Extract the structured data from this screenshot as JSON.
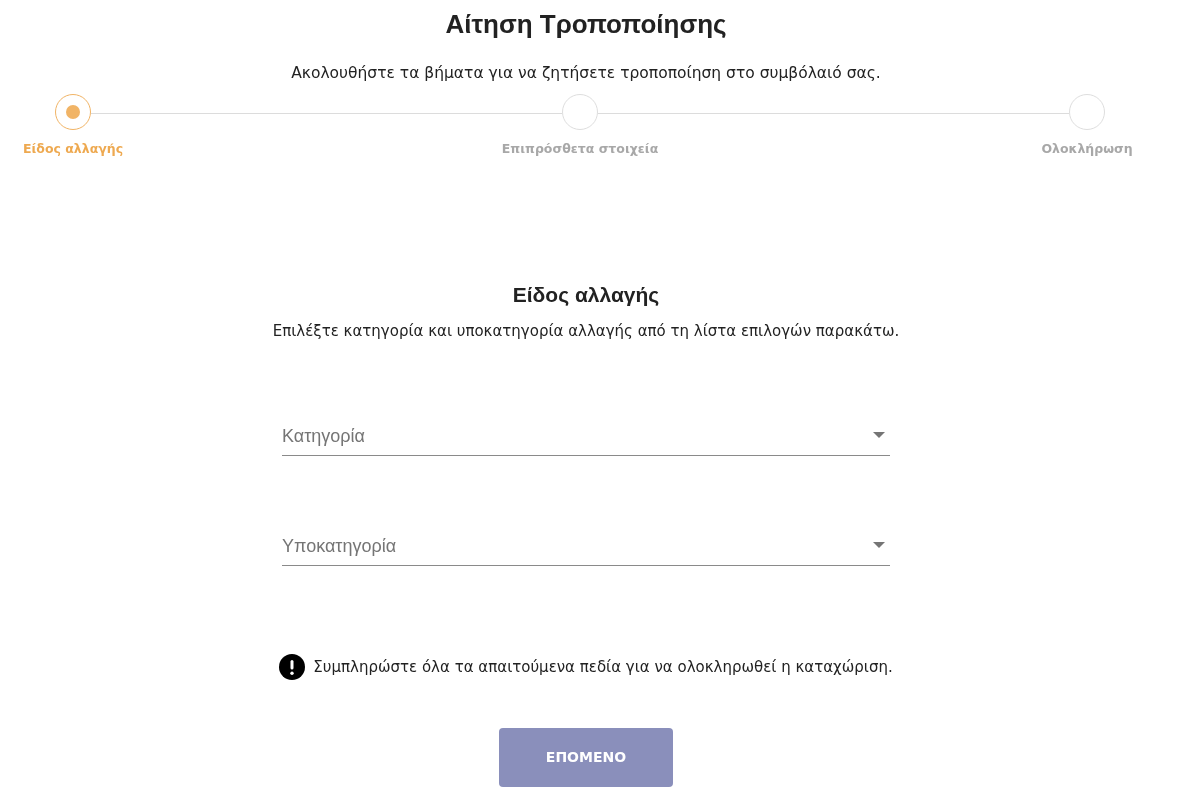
{
  "page": {
    "title": "Αίτηση Τροποποίησης",
    "subtitle": "Ακολουθήστε τα βήματα για να ζητήσετε τροποποίηση στο συμβόλαιό σας."
  },
  "steps": [
    {
      "label": "Είδος αλλαγής",
      "selected": true
    },
    {
      "label": "Επιπρόσθετα στοιχεία",
      "selected": false
    },
    {
      "label": "Ολοκλήρωση",
      "selected": false
    }
  ],
  "section": {
    "title": "Είδος αλλαγής",
    "description": "Επιλέξτε κατηγορία και υποκατηγορία αλλαγής από τη λίστα επιλογών παρακάτω."
  },
  "fields": [
    {
      "placeholder": "Κατηγορία"
    },
    {
      "placeholder": "Υποκατηγορία"
    }
  ],
  "notice": {
    "text": "Συμπληρώστε όλα τα απαιτούμενα πεδία για να ολοκληρωθεί η καταχώριση."
  },
  "button": {
    "label": "ΕΠΟΜΕΝΟ",
    "disabled": true
  }
}
